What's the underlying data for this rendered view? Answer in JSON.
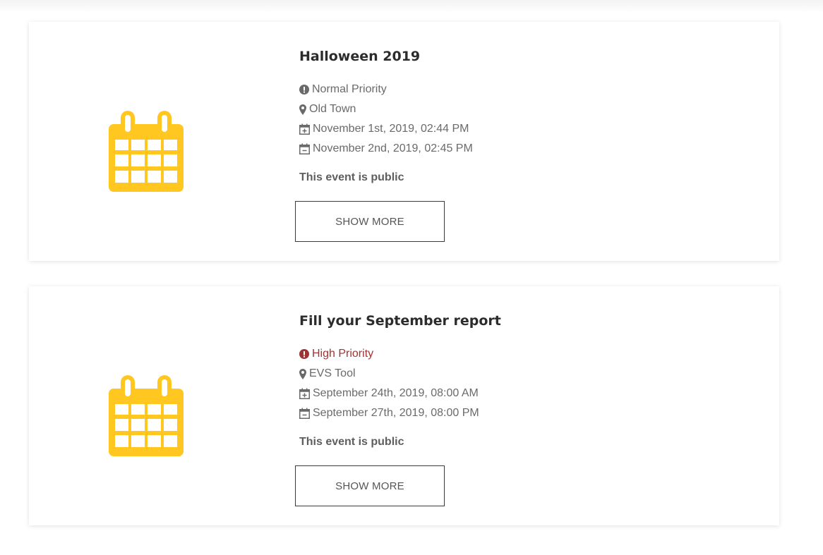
{
  "colors": {
    "calendar_icon": "#FFC720",
    "high_priority": "#9E3433",
    "meta_text": "#6A6A6A",
    "title_text": "#2C2C2C"
  },
  "events": [
    {
      "title": "Halloween 2019",
      "icon": "calendar-icon",
      "priority": {
        "label": "Normal Priority",
        "icon": "exclamation-circle-icon",
        "level": "normal"
      },
      "location": {
        "label": "Old Town",
        "icon": "map-marker-icon"
      },
      "start": {
        "label": "November 1st, 2019, 02:44 PM",
        "icon": "calendar-plus-icon"
      },
      "end": {
        "label": "November 2nd, 2019, 02:45 PM",
        "icon": "calendar-minus-icon"
      },
      "visibility": "This event is public",
      "button_label": "SHOW MORE"
    },
    {
      "title": "Fill your September report",
      "icon": "calendar-icon",
      "priority": {
        "label": "High Priority",
        "icon": "exclamation-circle-icon",
        "level": "high"
      },
      "location": {
        "label": "EVS Tool",
        "icon": "map-marker-icon"
      },
      "start": {
        "label": "September 24th, 2019, 08:00 AM",
        "icon": "calendar-plus-icon"
      },
      "end": {
        "label": "September 27th, 2019, 08:00 PM",
        "icon": "calendar-minus-icon"
      },
      "visibility": "This event is public",
      "button_label": "SHOW MORE"
    }
  ]
}
